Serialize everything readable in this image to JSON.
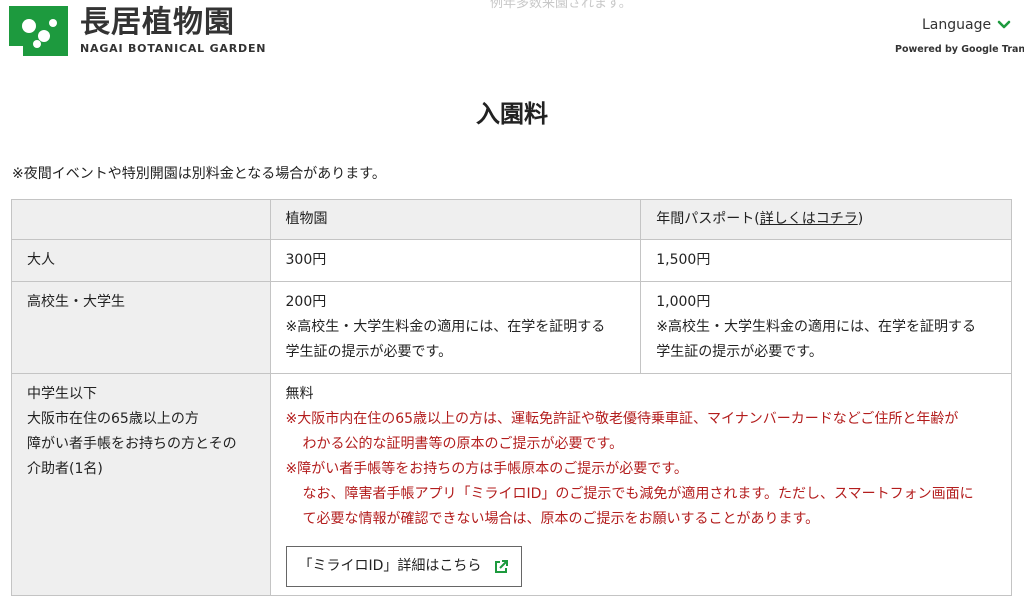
{
  "header": {
    "faded_text": "例年多数来園されます。",
    "logo_jp": "長居植物園",
    "logo_en": "NAGAI BOTANICAL GARDEN",
    "language_label": "Language",
    "powered_by": "Powered by Google Translate"
  },
  "page": {
    "title": "入園料",
    "notice": "※夜間イベントや特別開園は別料金となる場合があります。"
  },
  "table": {
    "headers": {
      "col2": "植物園",
      "col3_prefix": "年間パスポート(",
      "col3_link": "詳しくはコチラ",
      "col3_suffix": ")"
    },
    "rows": {
      "adult": {
        "label": "大人",
        "garden": "300円",
        "passport": "1,500円"
      },
      "student": {
        "label": "高校生・大学生",
        "garden": "200円",
        "garden_note1": "※高校生・大学生料金の適用には、在学を証明する",
        "garden_note2": "学生証の提示が必要です。",
        "passport": "1,000円",
        "passport_note1": "※高校生・大学生料金の適用には、在学を証明する",
        "passport_note2": "学生証の提示が必要です。"
      },
      "free": {
        "label1": "中学生以下",
        "label2": "大阪市在住の65歳以上の方",
        "label3": "障がい者手帳をお持ちの方とその",
        "label4": "介助者(1名)",
        "value": "無料",
        "note1a": "※大阪市内在住の65歳以上の方は、運転免許証や敬老優待乗車証、マイナンバーカードなどご住所と年齢が",
        "note1b": "わかる公的な証明書等の原本のご提示が必要です。",
        "note2a": "※障がい者手帳等をお持ちの方は手帳原本のご提示が必要です。",
        "note2b": "なお、障害者手帳アプリ「ミライロID」のご提示でも減免が適用されます。ただし、スマートフォン画面に",
        "note2c": "て必要な情報が確認できない場合は、原本のご提示をお願いすることがあります。",
        "button_label": "「ミライロID」詳細はこちら"
      }
    }
  },
  "colors": {
    "brand_green": "#1d9a3e",
    "warning_red": "#b31d1d",
    "header_bg": "#efefef"
  },
  "icons": {
    "logo": "garden-logo-icon",
    "language_chevron": "chevron-down-icon",
    "external": "external-link-icon"
  }
}
